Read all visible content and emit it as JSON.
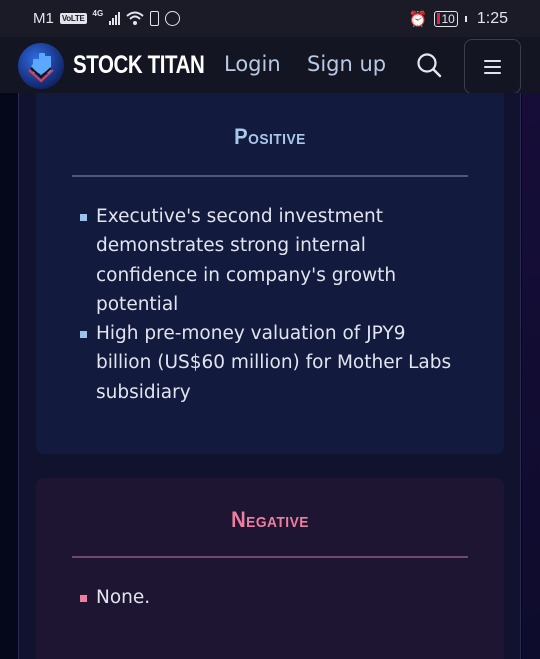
{
  "status_bar": {
    "carrier": "M1",
    "volte_badge": "VoLTE",
    "network_type": "4G",
    "battery_level": "10",
    "time": "1:25",
    "icons": [
      "signal-icon",
      "wifi-icon",
      "battery-saver-icon",
      "whatsapp-icon",
      "alarm-icon",
      "battery-icon"
    ]
  },
  "navbar": {
    "brand": "STOCK TITAN",
    "login_label": "Login",
    "signup_label": "Sign up",
    "search_icon": "search-icon",
    "menu_icon": "hamburger-menu-icon"
  },
  "sections": {
    "positive": {
      "title": "Positive",
      "accent_color": "#a8c8ec",
      "items": [
        "Executive's second investment demonstrates strong internal confidence in company's growth potential",
        "High pre-money valuation of JPY9 billion (US$60 million) for Mother Labs subsidiary"
      ]
    },
    "negative": {
      "title": "Negative",
      "accent_color": "#ee7ea0",
      "items": [
        "None."
      ]
    }
  }
}
